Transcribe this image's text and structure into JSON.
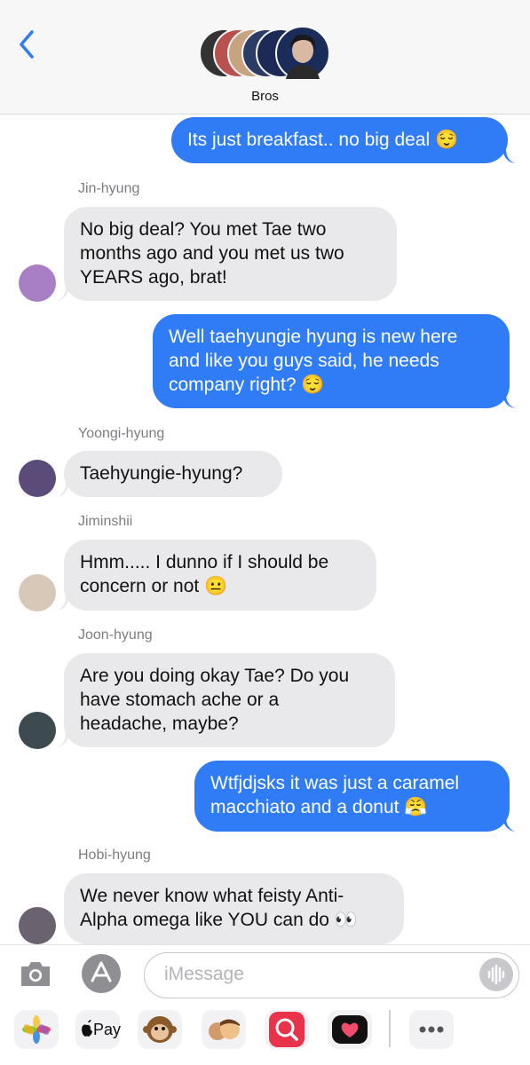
{
  "header": {
    "back_icon": "chevron-left-icon",
    "group_name": "Bros",
    "avatar_colors": [
      "#3a3a3a",
      "#b9524f",
      "#c7a37f",
      "#2b3c66",
      "#1d2a55",
      "#1a2d5a"
    ]
  },
  "messages": [
    {
      "type": "outgoing",
      "text": "Its just breakfast.. no big deal 😌"
    },
    {
      "type": "incoming",
      "sender": "Jin-hyung",
      "text": "No big deal? You met Tae two\nmonths ago and you met us two\nYEARS ago, brat!",
      "avatar_color": "#a87ec5"
    },
    {
      "type": "outgoing",
      "text": "Well taehyungie hyung is new here\nand like you guys said, he needs\ncompany right? 😌"
    },
    {
      "type": "incoming",
      "sender": "Yoongi-hyung",
      "text": "Taehyungie-hyung?",
      "avatar_color": "#5a4b7a"
    },
    {
      "type": "incoming",
      "sender": "Jiminshii",
      "text": "Hmm..... I dunno if I should be\nconcern or not 😐",
      "avatar_color": "#d8c8b8"
    },
    {
      "type": "incoming",
      "sender": "Joon-hyung",
      "text": "Are you doing okay Tae? Do you\nhave stomach ache or a\nheadache, maybe?",
      "avatar_color": "#3d4a4f"
    },
    {
      "type": "outgoing",
      "text": "Wtfjdjsks it was just a caramel\nmacchiato and a donut 😤"
    },
    {
      "type": "incoming",
      "sender": "Hobi-hyung",
      "text": "We never know what feisty Anti-\nAlpha omega like YOU can do 👀",
      "avatar_color": "#6b6270"
    }
  ],
  "composer": {
    "camera_icon": "camera-icon",
    "apps_icon": "app-store-icon",
    "placeholder": "iMessage",
    "voice_icon": "waveform-icon"
  },
  "tray": {
    "photos_icon": "photos-icon",
    "apple_pay_label": "Pay",
    "memoji_icon": "monkey-icon",
    "memoji_stickers_icon": "memoji-icon",
    "search_icon": "globe-search-icon",
    "digital_touch_icon": "heart-touch-icon",
    "more_icon": "more-icon"
  },
  "colors": {
    "outgoing_bubble": "#2f7cf6",
    "incoming_bubble": "#e9e9eb",
    "sender_label": "#7d7d82"
  }
}
